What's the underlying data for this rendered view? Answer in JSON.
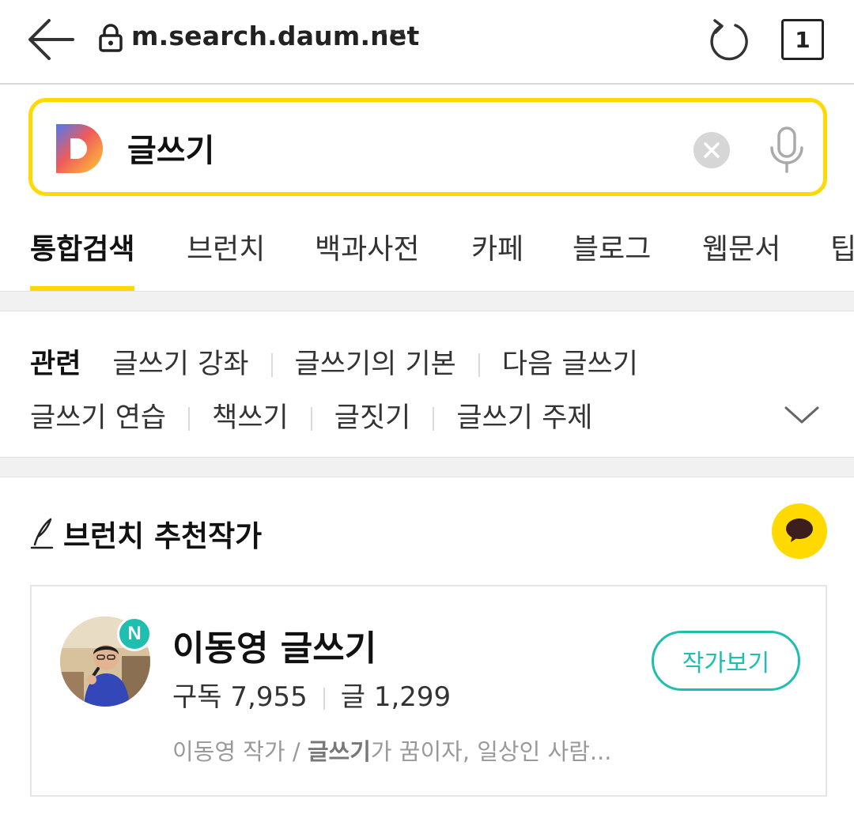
{
  "browser": {
    "url": "m.search.daum.net",
    "more": "···",
    "tab_count": "1"
  },
  "search": {
    "query": "글쓰기"
  },
  "category_tabs": [
    {
      "label": "통합검색",
      "active": true
    },
    {
      "label": "브런치"
    },
    {
      "label": "백과사전"
    },
    {
      "label": "카페"
    },
    {
      "label": "블로그"
    },
    {
      "label": "웹문서"
    },
    {
      "label": "팁"
    }
  ],
  "related": {
    "label": "관련",
    "row1": [
      "글쓰기 강좌",
      "글쓰기의 기본",
      "다음 글쓰기"
    ],
    "row2": [
      "글쓰기 연습",
      "책쓰기",
      "글짓기",
      "글쓰기 주제"
    ]
  },
  "brunch": {
    "title": "브런치 추천작가",
    "author": {
      "name": "이동영 글쓰기",
      "badge": "N",
      "subscribers_label": "구독",
      "subscribers": "7,955",
      "posts_label": "글",
      "posts": "1,299",
      "view_button": "작가보기",
      "desc_prefix": "이동영 작가 / ",
      "desc_highlight": "글쓰기",
      "desc_suffix": "가 꿈이자, 일상인 사람..."
    }
  },
  "colors": {
    "accent_yellow": "#ffd900",
    "brunch_teal": "#1fbfb0"
  }
}
